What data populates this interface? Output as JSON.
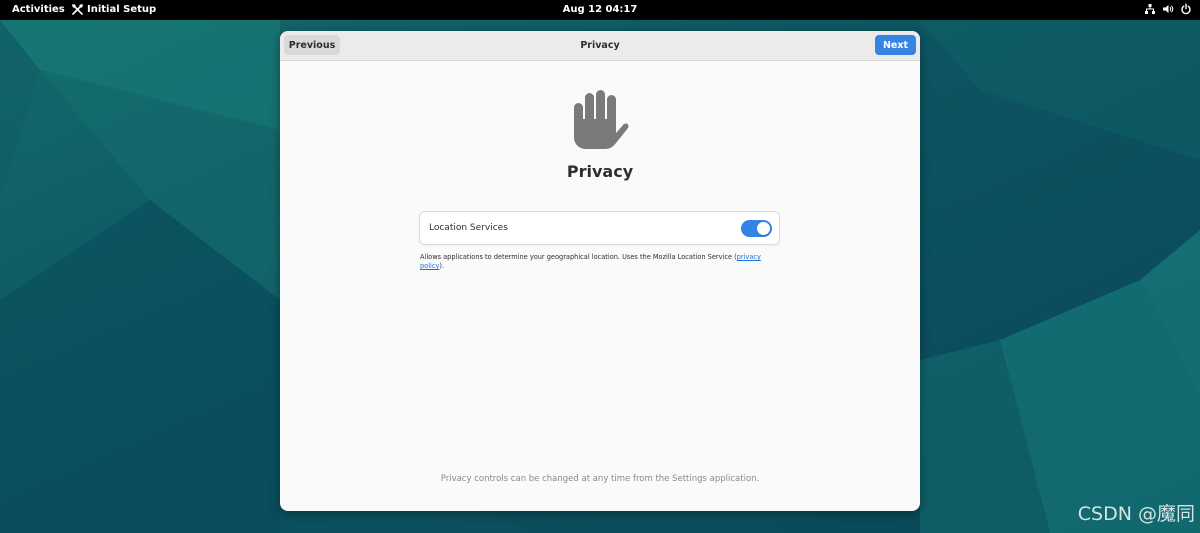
{
  "topbar": {
    "activities_label": "Activities",
    "app_name": "Initial Setup",
    "clock": "Aug 12  04:17",
    "tray_icons": [
      "network-icon",
      "volume-icon",
      "power-icon"
    ]
  },
  "dialog": {
    "header": {
      "previous_label": "Previous",
      "title": "Privacy",
      "next_label": "Next"
    },
    "icon": "hand-icon",
    "heading": "Privacy",
    "location_services": {
      "label": "Location Services",
      "enabled": true
    },
    "description": {
      "text": "Allows applications to determine your geographical location. Uses the Mozilla Location Service (",
      "link_text": "privacy policy",
      "suffix": ")."
    },
    "footer_note": "Privacy controls can be changed at any time from the Settings application."
  },
  "watermark": "CSDN @魔同",
  "colors": {
    "accent": "#3584e4",
    "topbar": "#000000",
    "wallpaper": "#0c4f5c",
    "dialog_bg": "#fafafa"
  }
}
